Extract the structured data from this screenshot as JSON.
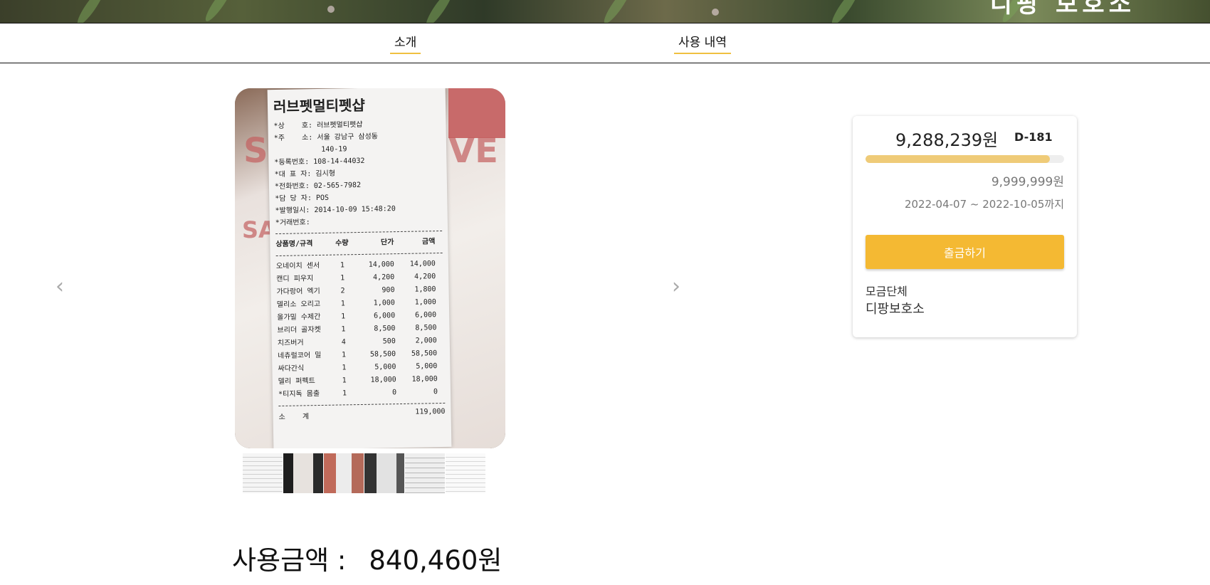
{
  "banner": {
    "title_fragment": "디팡 보호소"
  },
  "tabs": [
    {
      "label": "소개"
    },
    {
      "label": "사용 내역"
    }
  ],
  "receipt": {
    "title": "러브펫멀티펫샵",
    "header_lines": [
      "*상    호: 러브펫멀티펫샵",
      "*주    소: 서울 강남구 삼성동",
      "           140-19",
      "*등록번호: 108-14-44032",
      "*대 표 자: 김시형",
      "*전화번호: 02-565-7982",
      "*담 당 자: POS",
      "*발행일시: 2014-10-09 15:48:20",
      "*거래번호:"
    ],
    "columns": [
      "상품명/규격",
      "수량",
      "단가",
      "금액"
    ],
    "items": [
      [
        "오네이치 센서",
        "1",
        "14,000",
        "14,000"
      ],
      [
        "캔디 피우지",
        "1",
        "4,200",
        "4,200"
      ],
      [
        "가다랑어 엑기",
        "2",
        "900",
        "1,800"
      ],
      [
        "델리소 오리고",
        "1",
        "1,000",
        "1,000"
      ],
      [
        "올가밀 수제간",
        "1",
        "6,000",
        "6,000"
      ],
      [
        "브리더 골자켓",
        "1",
        "8,500",
        "8,500"
      ],
      [
        "치즈버거",
        "4",
        "500",
        "2,000"
      ],
      [
        "네츄럴코어 밀",
        "1",
        "58,500",
        "58,500"
      ],
      [
        "싸다간식",
        "1",
        "5,000",
        "5,000"
      ],
      [
        "델리 퍼펙트",
        "1",
        "18,000",
        "18,000"
      ],
      [
        "*티지독 몸출",
        "1",
        "0",
        "0"
      ]
    ],
    "subtotal_label": "소    계",
    "subtotal_value": "119,000"
  },
  "card": {
    "current_amount": "9,288,239원",
    "dday": "D-181",
    "progress_fraction": 0.929,
    "goal_amount": "9,999,999원",
    "period": "2022-04-07 ~ 2022-10-05까지",
    "withdraw_label": "출금하기",
    "org_label": "모금단체",
    "org_name": "디팡보호소"
  },
  "used": {
    "label": "사용금액 :",
    "amount": "840,460원"
  },
  "colors": {
    "accent": "#f4b933",
    "progress": "#efcb78",
    "tab_underline": "#f0c040"
  }
}
